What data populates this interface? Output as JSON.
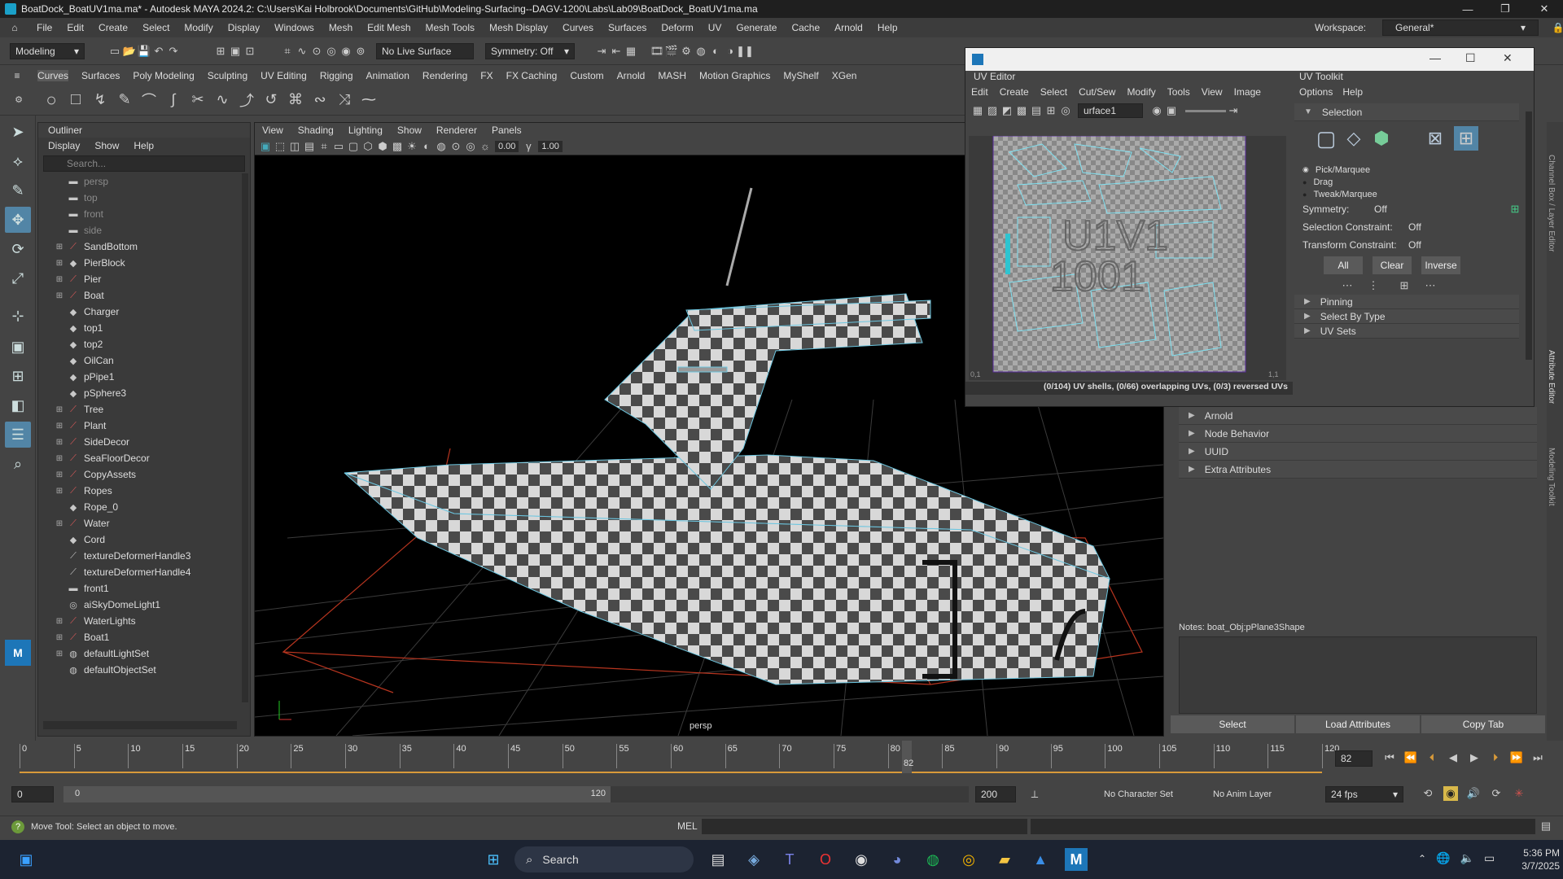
{
  "window": {
    "title": "BoatDock_BoatUV1ma.ma* - Autodesk MAYA 2024.2: C:\\Users\\Kai Holbrook\\Documents\\GitHub\\Modeling-Surfacing--DAGV-1200\\Labs\\Lab09\\BoatDock_BoatUV1ma.ma"
  },
  "menubar": [
    "File",
    "Edit",
    "Create",
    "Select",
    "Modify",
    "Display",
    "Windows",
    "Mesh",
    "Edit Mesh",
    "Mesh Tools",
    "Mesh Display",
    "Curves",
    "Surfaces",
    "Deform",
    "UV",
    "Generate",
    "Cache",
    "Arnold",
    "Help"
  ],
  "workspace": {
    "label": "Workspace:",
    "value": "General*"
  },
  "statusline": {
    "mode": "Modeling",
    "live_surface": "No Live Surface",
    "symmetry": "Symmetry: Off"
  },
  "shelf_tabs": [
    "Curves",
    "Surfaces",
    "Poly Modeling",
    "Sculpting",
    "UV Editing",
    "Rigging",
    "Animation",
    "Rendering",
    "FX",
    "FX Caching",
    "Custom",
    "Arnold",
    "MASH",
    "Motion Graphics",
    "MyShelf",
    "XGen"
  ],
  "outliner": {
    "title": "Outliner",
    "menu": [
      "Display",
      "Show",
      "Help"
    ],
    "search_placeholder": "Search...",
    "items": [
      {
        "label": "persp",
        "icon": "camera-icon",
        "expandable": false,
        "dim": true
      },
      {
        "label": "top",
        "icon": "camera-icon",
        "expandable": false,
        "dim": true
      },
      {
        "label": "front",
        "icon": "camera-icon",
        "expandable": false,
        "dim": true
      },
      {
        "label": "side",
        "icon": "camera-icon",
        "expandable": false,
        "dim": true
      },
      {
        "label": "SandBottom",
        "icon": "mesh-icon",
        "expandable": true,
        "dim": false
      },
      {
        "label": "PierBlock",
        "icon": "group-icon",
        "expandable": true,
        "dim": false
      },
      {
        "label": "Pier",
        "icon": "mesh-icon",
        "expandable": true,
        "dim": false
      },
      {
        "label": "Boat",
        "icon": "mesh-icon",
        "expandable": true,
        "dim": false
      },
      {
        "label": "Charger",
        "icon": "group-icon",
        "expandable": false,
        "dim": false
      },
      {
        "label": "top1",
        "icon": "group-icon",
        "expandable": false,
        "dim": false
      },
      {
        "label": "top2",
        "icon": "group-icon",
        "expandable": false,
        "dim": false
      },
      {
        "label": "OilCan",
        "icon": "group-icon",
        "expandable": false,
        "dim": false
      },
      {
        "label": "pPipe1",
        "icon": "group-icon",
        "expandable": false,
        "dim": false
      },
      {
        "label": "pSphere3",
        "icon": "group-icon",
        "expandable": false,
        "dim": false
      },
      {
        "label": "Tree",
        "icon": "mesh-icon",
        "expandable": true,
        "dim": false
      },
      {
        "label": "Plant",
        "icon": "mesh-icon",
        "expandable": true,
        "dim": false
      },
      {
        "label": "SideDecor",
        "icon": "mesh-icon",
        "expandable": true,
        "dim": false
      },
      {
        "label": "SeaFloorDecor",
        "icon": "mesh-icon",
        "expandable": true,
        "dim": false
      },
      {
        "label": "CopyAssets",
        "icon": "mesh-icon",
        "expandable": true,
        "dim": false
      },
      {
        "label": "Ropes",
        "icon": "mesh-icon",
        "expandable": true,
        "dim": false
      },
      {
        "label": "Rope_0",
        "icon": "group-icon",
        "expandable": false,
        "dim": false
      },
      {
        "label": "Water",
        "icon": "mesh-icon",
        "expandable": true,
        "dim": false
      },
      {
        "label": "Cord",
        "icon": "group-icon",
        "expandable": false,
        "dim": false
      },
      {
        "label": "textureDeformerHandle3",
        "icon": "deformer-icon",
        "expandable": false,
        "dim": false
      },
      {
        "label": "textureDeformerHandle4",
        "icon": "deformer-icon",
        "expandable": false,
        "dim": false
      },
      {
        "label": "front1",
        "icon": "camera-icon",
        "expandable": false,
        "dim": false
      },
      {
        "label": "aiSkyDomeLight1",
        "icon": "light-icon",
        "expandable": false,
        "dim": false
      },
      {
        "label": "WaterLights",
        "icon": "mesh-icon",
        "expandable": true,
        "dim": false
      },
      {
        "label": "Boat1",
        "icon": "mesh-icon",
        "expandable": true,
        "dim": false
      },
      {
        "label": "defaultLightSet",
        "icon": "set-icon",
        "expandable": true,
        "dim": false
      },
      {
        "label": "defaultObjectSet",
        "icon": "set-icon",
        "expandable": false,
        "dim": false
      }
    ]
  },
  "viewport": {
    "menu": [
      "View",
      "Shading",
      "Lighting",
      "Show",
      "Renderer",
      "Panels"
    ],
    "near": "0.00",
    "far": "1.00",
    "camera_label": "persp"
  },
  "uv_editor": {
    "title": "UV Editor",
    "menu": [
      "Edit",
      "Create",
      "Select",
      "Cut/Sew",
      "Modify",
      "Tools",
      "View",
      "Image"
    ],
    "texture_field": "urface1",
    "tile_label_top": "U1V1",
    "tile_label_bottom": "1001",
    "corner_left": "0,1",
    "corner_right": "1,1",
    "status": "(0/104) UV shells, (0/66) overlapping UVs, (0/3) reversed UVs"
  },
  "uv_toolkit": {
    "title": "UV Toolkit",
    "menu": [
      "Options",
      "Help"
    ],
    "section_selection": "Selection",
    "modes": [
      "Pick/Marquee",
      "Drag",
      "Tweak/Marquee"
    ],
    "symmetry_label": "Symmetry:",
    "symmetry_value": "Off",
    "sel_constraint_label": "Selection Constraint:",
    "sel_constraint_value": "Off",
    "transform_constraint_label": "Transform Constraint:",
    "transform_constraint_value": "Off",
    "buttons": [
      "All",
      "Clear",
      "Inverse"
    ],
    "sections": [
      "Pinning",
      "Select By Type",
      "UV Sets"
    ]
  },
  "attribute_editor": {
    "sections": [
      "Arnold",
      "Node Behavior",
      "UUID",
      "Extra Attributes"
    ],
    "notes_label": "Notes:  boat_Obj:pPlane3Shape",
    "bottom_buttons": [
      "Select",
      "Load Attributes",
      "Copy Tab"
    ],
    "side_tabs": [
      "Channel Box / Layer Editor",
      "Attribute Editor",
      "Modeling Toolkit"
    ]
  },
  "timeline": {
    "ticks": [
      "0",
      "5",
      "10",
      "15",
      "20",
      "25",
      "30",
      "35",
      "40",
      "45",
      "50",
      "55",
      "60",
      "65",
      "70",
      "75",
      "80",
      "85",
      "90",
      "95",
      "100",
      "105",
      "110",
      "115",
      "120"
    ],
    "current_frame": "82",
    "current_frame_field": "82"
  },
  "range": {
    "start": "0",
    "range_start": "0",
    "range_end": "120",
    "end": "200",
    "character_set": "No Character Set",
    "anim_layer": "No Anim Layer",
    "fps": "24 fps"
  },
  "cmdline": {
    "help": "Move Tool: Select an object to move.",
    "lang": "MEL"
  },
  "taskbar": {
    "search": "Search",
    "time": "5:36 PM",
    "date": "3/7/2025"
  }
}
